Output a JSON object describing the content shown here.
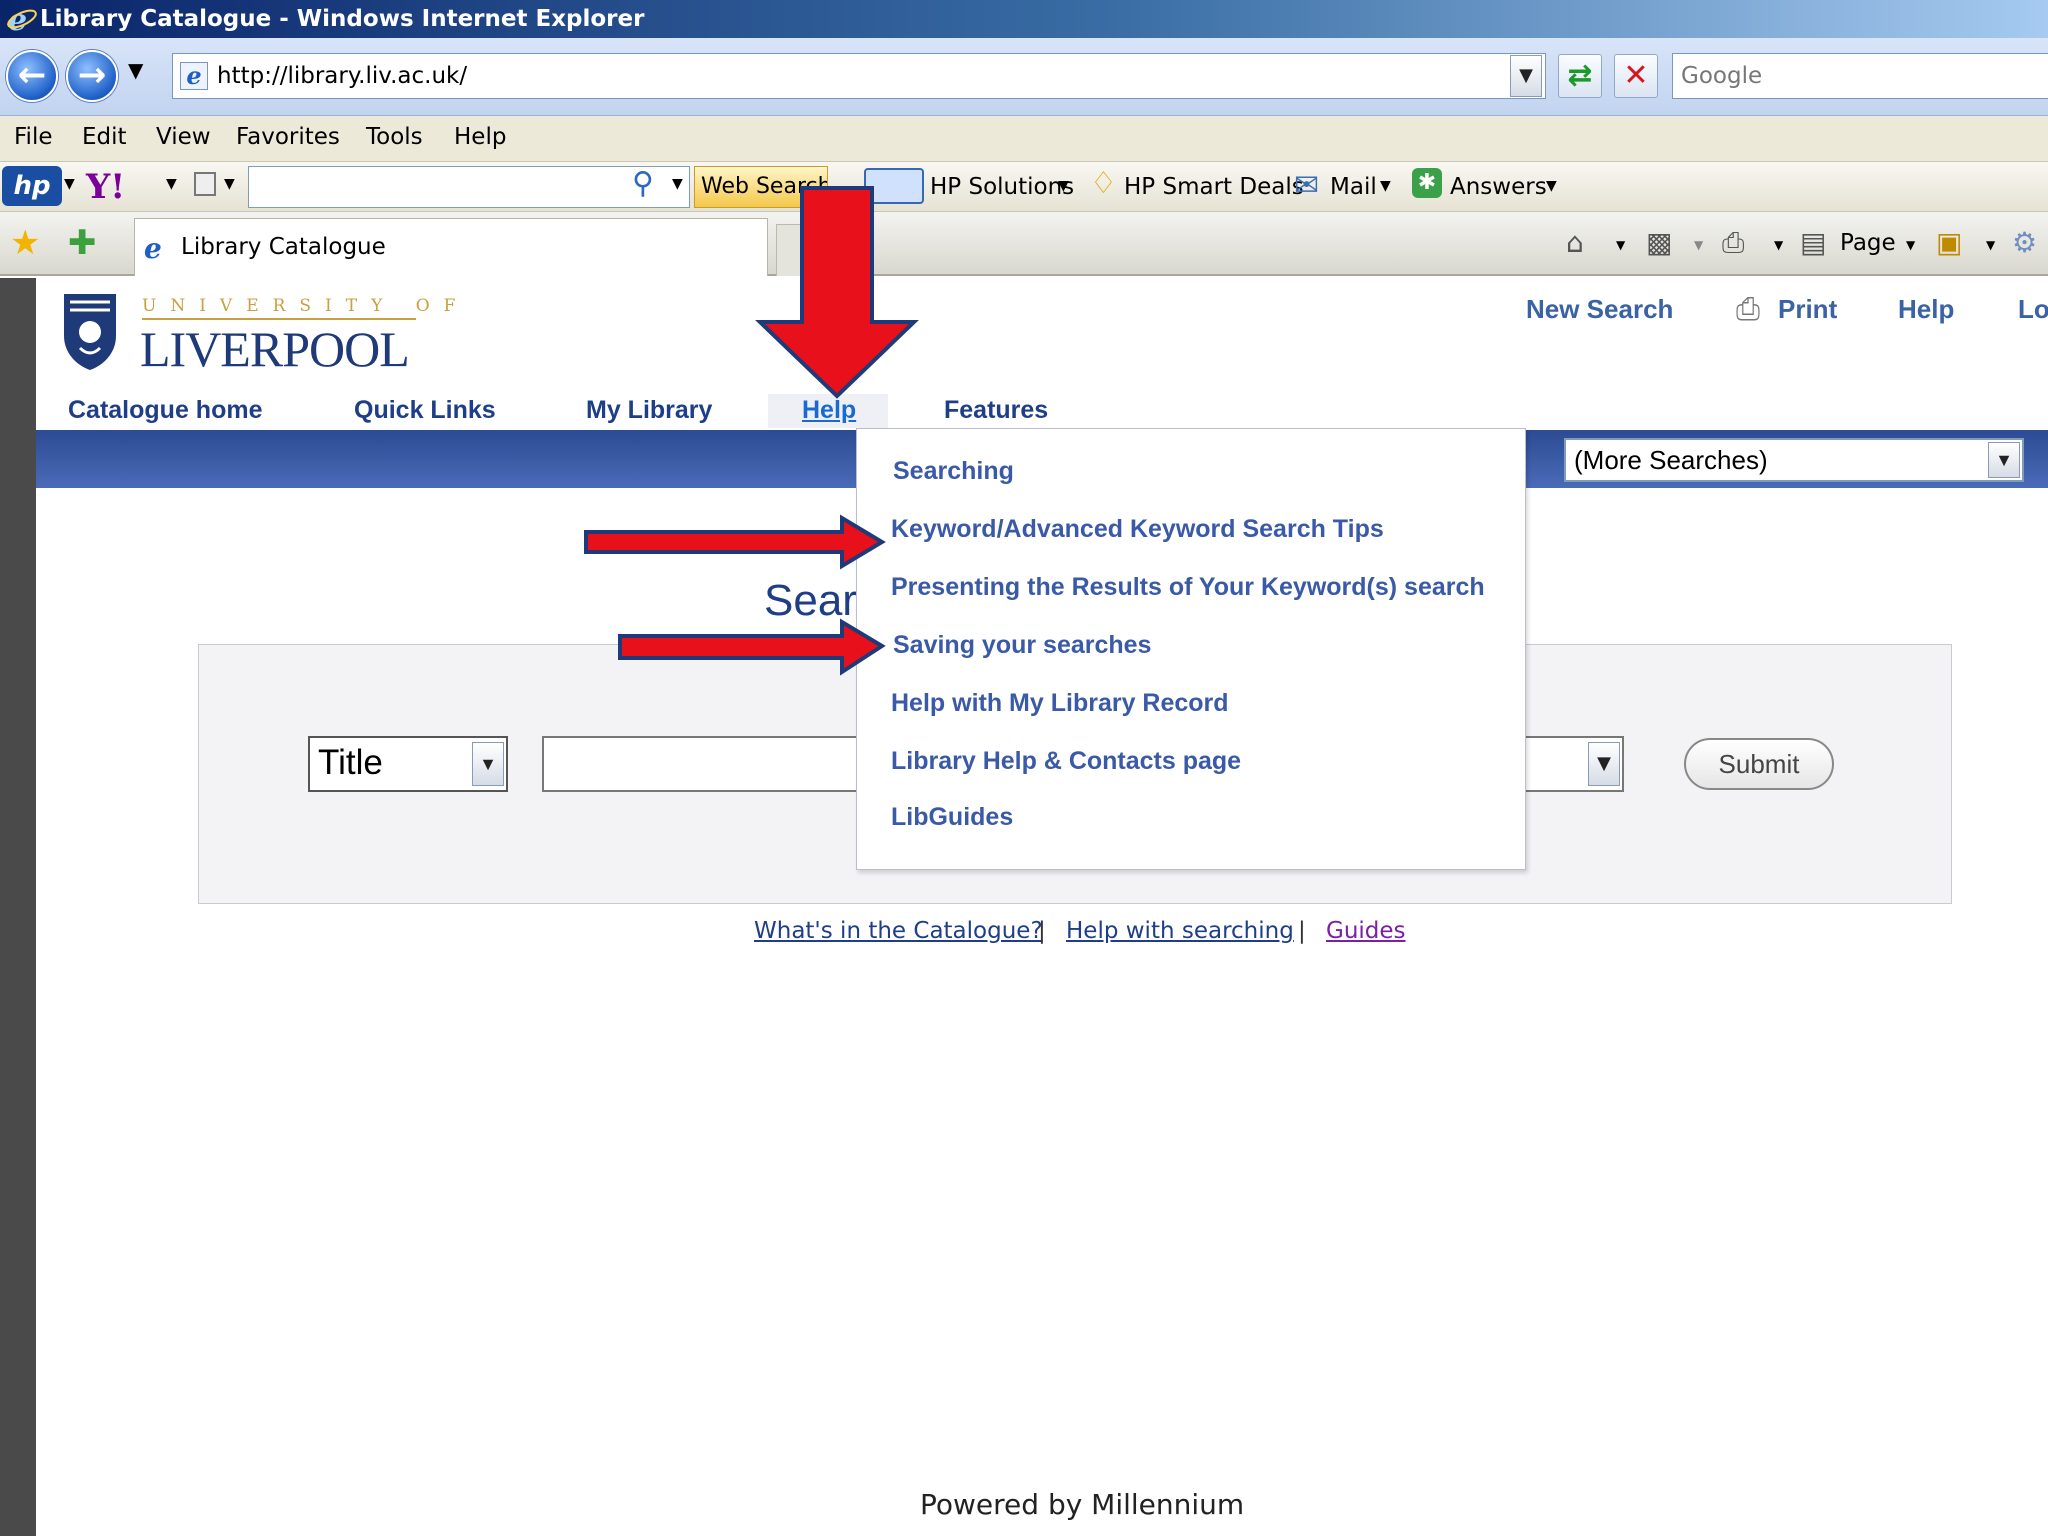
{
  "browser": {
    "window_title": "Library Catalogue - Windows Internet Explorer",
    "address": "http://library.liv.ac.uk/",
    "search_placeholder": "Google",
    "menu": [
      "File",
      "Edit",
      "View",
      "Favorites",
      "Tools",
      "Help"
    ],
    "toolbar": {
      "web_search": "Web Search",
      "hp_solutions": "HP Solutions",
      "hp_smart_deals": "HP Smart Deals",
      "mail": "Mail",
      "answers": "Answers"
    },
    "tab_title": "Library Catalogue",
    "page_menu": "Page"
  },
  "site": {
    "logo_top": "UNIVERSITY OF",
    "logo_name": "LIVERPOOL",
    "top_links": [
      "New Search",
      "Print",
      "Help",
      "Lo"
    ],
    "nav": [
      "Catalogue home",
      "Quick Links",
      "My Library",
      "Help",
      "Features"
    ],
    "more_searches": "(More Searches)",
    "search_title": "Sear",
    "search_field": "Title",
    "submit": "Submit",
    "footer_links": [
      "What's in the Catalogue?",
      "Help with searching",
      "Guides"
    ],
    "footer_separator": "|",
    "powered_by": "Powered by Millennium"
  },
  "help_menu": [
    "Searching",
    "Keyword/Advanced Keyword Search Tips",
    "Presenting the Results of Your Keyword(s) search",
    "Saving your searches",
    "Help with My Library Record",
    "Library Help & Contacts page",
    "LibGuides"
  ],
  "colors": {
    "link_blue": "#1f3e88",
    "band_blue": "#2c4b93",
    "arrow_red": "#e8101a",
    "arrow_outline": "#1e3a78",
    "visited_purple": "#7a1fa8"
  }
}
